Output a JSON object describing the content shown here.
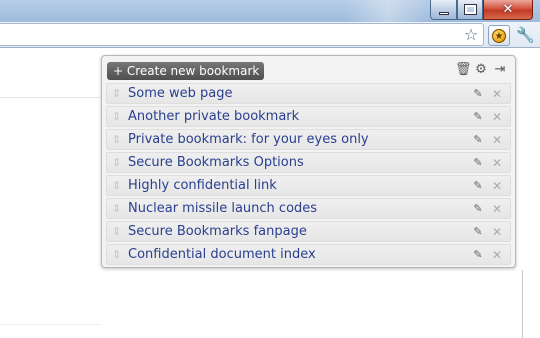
{
  "window": {
    "minimize_glyph": "",
    "maximize_glyph": "",
    "close_glyph": "✕"
  },
  "toolbar": {
    "star_icon": "☆",
    "extension_icon": "★",
    "wrench_icon": "🔧"
  },
  "popup": {
    "create_label": "+ Create new bookmark",
    "trash_icon": "🗑",
    "settings_icon": "⚙",
    "export_icon": "⇥",
    "items": [
      {
        "label": "Some web page"
      },
      {
        "label": "Another private bookmark"
      },
      {
        "label": "Private bookmark: for your eyes only"
      },
      {
        "label": "Secure Bookmarks Options"
      },
      {
        "label": "Highly confidential link"
      },
      {
        "label": "Nuclear missile launch codes"
      },
      {
        "label": "Secure Bookmarks fanpage"
      },
      {
        "label": "Confidential document index"
      }
    ],
    "drag_glyph": "⇕",
    "edit_glyph": "✎",
    "delete_glyph": "✕"
  },
  "colors": {
    "link_text": "#2a3f8f",
    "create_button_bg": "#5a5a5a",
    "close_button": "#c8452e"
  }
}
